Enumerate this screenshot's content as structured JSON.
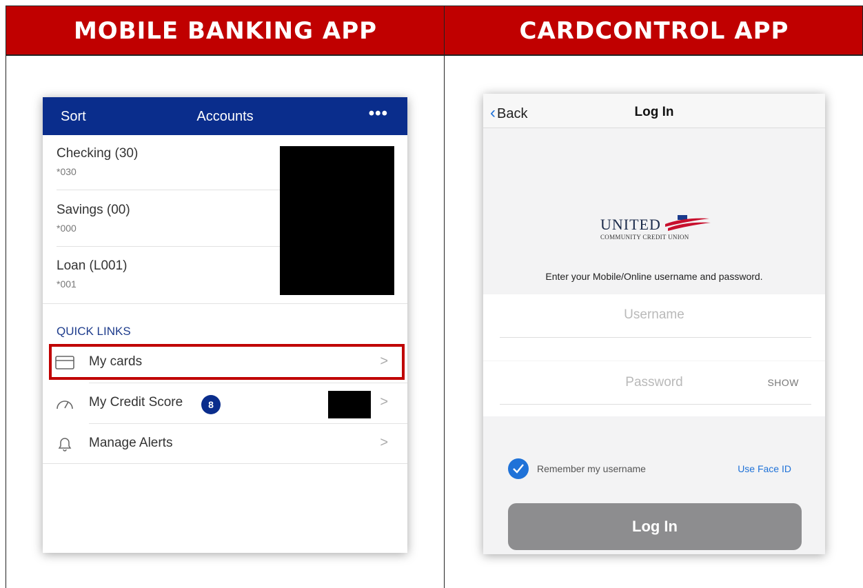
{
  "headers": {
    "left": "MOBILE BANKING APP",
    "right": "CARDCONTROL APP"
  },
  "mobile_banking": {
    "nav": {
      "sort": "Sort",
      "title": "Accounts",
      "more": "•••"
    },
    "accounts": [
      {
        "name": "Checking (30)",
        "number": "*030"
      },
      {
        "name": "Savings (00)",
        "number": "*000"
      },
      {
        "name": "Loan (L001)",
        "number": "*001"
      }
    ],
    "quick_links_title": "QUICK LINKS",
    "quick_links": [
      {
        "label": "My cards",
        "icon": "credit-card-icon",
        "chevron": ">"
      },
      {
        "label": "My Credit Score",
        "icon": "gauge-icon",
        "badge": "8",
        "chevron": ">"
      },
      {
        "label": "Manage Alerts",
        "icon": "bell-icon",
        "chevron": ">"
      }
    ],
    "colors": {
      "nav": "#0a2d8c",
      "highlight": "#c00000",
      "quick_links_title": "#1e3c8c"
    }
  },
  "cardcontrol": {
    "nav": {
      "back": "Back",
      "title": "Log In"
    },
    "logo": {
      "word": "UNITED",
      "sub": "COMMUNITY CREDIT UNION"
    },
    "prompt": "Enter your Mobile/Online username and password.",
    "username_placeholder": "Username",
    "password_placeholder": "Password",
    "show_label": "SHOW",
    "remember_label": "Remember my username",
    "face_id_label": "Use Face ID",
    "login_label": "Log In",
    "colors": {
      "accent": "#1f72d8",
      "button": "#8d8d8f"
    }
  }
}
